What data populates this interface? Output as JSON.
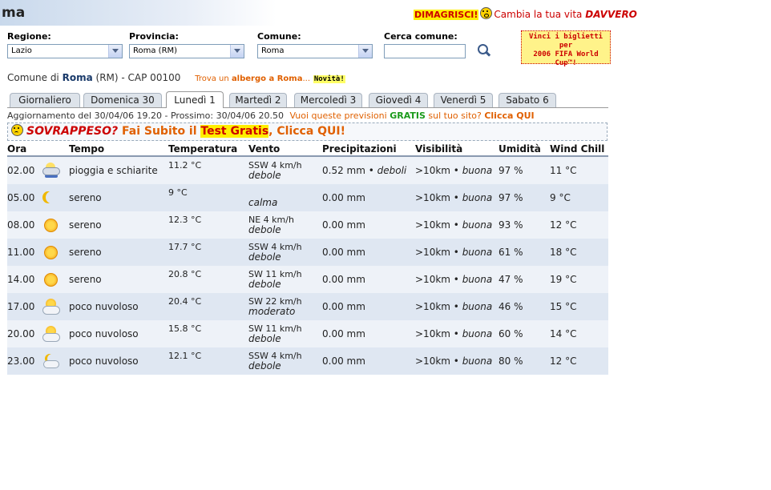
{
  "header": {
    "title": "ma"
  },
  "promo": {
    "word1": "DIMAGRISCI!",
    "word2": "Cambia la tua vita",
    "word3": "DAVVERO"
  },
  "filters": {
    "regione_label": "Regione:",
    "regione_value": "Lazio",
    "provincia_label": "Provincia:",
    "provincia_value": "Roma (RM)",
    "comune_label": "Comune:",
    "comune_value": "Roma",
    "cerca_label": "Cerca comune:",
    "cerca_value": ""
  },
  "fifa_ad": {
    "line1": "Vinci i biglietti per",
    "line2": "2006 FIFA World",
    "line3": "Cup™!"
  },
  "location": {
    "prefix": "Comune di",
    "city": "Roma",
    "suffix": "(RM) - CAP 00100",
    "hotel_prefix": "Trova un",
    "hotel_link": "albergo a Roma",
    "hotel_suffix": "...",
    "new_badge": "Novità!"
  },
  "tabs": [
    "Giornaliero",
    "Domenica 30",
    "Lunedì 1",
    "Martedì 2",
    "Mercoledì 3",
    "Giovedì 4",
    "Venerdì 5",
    "Sabato 6"
  ],
  "active_tab": "Lunedì 1",
  "update": {
    "text": "Aggiornamento del 30/04/06 19.20 - Prossimo: 30/04/06 20.50",
    "ask": "Vuoi queste previsioni",
    "gratis": "GRATIS",
    "ask2": "sul tuo sito?",
    "qui": "Clicca QUI"
  },
  "banner": {
    "b1": "SOVRAPPESO?",
    "b2": "Fai Subito il",
    "b3": "Test Gratis",
    "b4": ", Clicca QUI!"
  },
  "table": {
    "headers": [
      "Ora",
      "Tempo",
      "Temperatura",
      "Vento",
      "Precipitazioni",
      "Visibilità",
      "Umidità",
      "Wind Chill"
    ],
    "rows": [
      {
        "ora": "02.00",
        "icon": "rain-cloud-icon",
        "tempo": "pioggia e schiarite",
        "temp": "11.2 °C",
        "vento1": "SSW 4 km/h",
        "vento2": "debole",
        "prec": "0.52 mm",
        "prec2": "deboli",
        "vis": ">10km",
        "vis2": "buona",
        "umid": "97 %",
        "chill": "11 °C"
      },
      {
        "ora": "05.00",
        "icon": "moon-icon",
        "tempo": "sereno",
        "temp": "9 °C",
        "vento1": "",
        "vento2": "calma",
        "prec": "0.00 mm",
        "prec2": "",
        "vis": ">10km",
        "vis2": "buona",
        "umid": "97 %",
        "chill": "9 °C"
      },
      {
        "ora": "08.00",
        "icon": "sun-icon",
        "tempo": "sereno",
        "temp": "12.3 °C",
        "vento1": "NE 4 km/h",
        "vento2": "debole",
        "prec": "0.00 mm",
        "prec2": "",
        "vis": ">10km",
        "vis2": "buona",
        "umid": "93 %",
        "chill": "12 °C"
      },
      {
        "ora": "11.00",
        "icon": "sun-icon",
        "tempo": "sereno",
        "temp": "17.7 °C",
        "vento1": "SSW 4 km/h",
        "vento2": "debole",
        "prec": "0.00 mm",
        "prec2": "",
        "vis": ">10km",
        "vis2": "buona",
        "umid": "61 %",
        "chill": "18 °C"
      },
      {
        "ora": "14.00",
        "icon": "sun-icon",
        "tempo": "sereno",
        "temp": "20.8 °C",
        "vento1": "SW 11 km/h",
        "vento2": "debole",
        "prec": "0.00 mm",
        "prec2": "",
        "vis": ">10km",
        "vis2": "buona",
        "umid": "47 %",
        "chill": "19 °C"
      },
      {
        "ora": "17.00",
        "icon": "sun-cloud-icon",
        "tempo": "poco nuvoloso",
        "temp": "20.4 °C",
        "vento1": "SW 22 km/h",
        "vento2": "moderato",
        "prec": "0.00 mm",
        "prec2": "",
        "vis": ">10km",
        "vis2": "buona",
        "umid": "46 %",
        "chill": "15 °C"
      },
      {
        "ora": "20.00",
        "icon": "sun-cloud-icon",
        "tempo": "poco nuvoloso",
        "temp": "15.8 °C",
        "vento1": "SW 11 km/h",
        "vento2": "debole",
        "prec": "0.00 mm",
        "prec2": "",
        "vis": ">10km",
        "vis2": "buona",
        "umid": "60 %",
        "chill": "14 °C"
      },
      {
        "ora": "23.00",
        "icon": "moon-cloud-icon",
        "tempo": "poco nuvoloso",
        "temp": "12.1 °C",
        "vento1": "SSW 4 km/h",
        "vento2": "debole",
        "prec": "0.00 mm",
        "prec2": "",
        "vis": ">10km",
        "vis2": "buona",
        "umid": "80 %",
        "chill": "12 °C"
      }
    ]
  }
}
